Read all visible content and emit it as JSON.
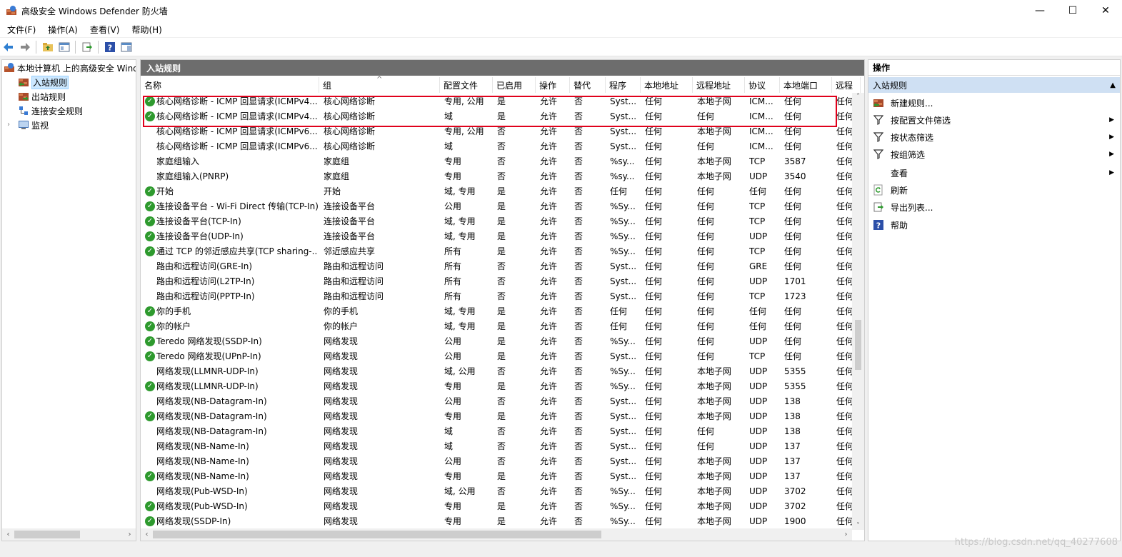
{
  "window": {
    "title": "高级安全 Windows Defender 防火墙",
    "min_glyph": "—",
    "max_glyph": "☐",
    "close_glyph": "✕"
  },
  "menu": [
    "文件(F)",
    "操作(A)",
    "查看(V)",
    "帮助(H)"
  ],
  "tree": {
    "root": "本地计算机 上的高级安全 Windows Defender 防火墙",
    "items": [
      "入站规则",
      "出站规则",
      "连接安全规则",
      "监视"
    ],
    "selected": "入站规则"
  },
  "center": {
    "header": "入站规则",
    "columns": [
      "名称",
      "组",
      "配置文件",
      "已启用",
      "操作",
      "替代",
      "程序",
      "本地地址",
      "远程地址",
      "协议",
      "本地端口",
      "远程"
    ],
    "rows": [
      {
        "enabled_icon": true,
        "cells": [
          "核心网络诊断 - ICMP 回显请求(ICMPv4...",
          "核心网络诊断",
          "专用, 公用",
          "是",
          "允许",
          "否",
          "Syst...",
          "任何",
          "本地子网",
          "ICM...",
          "任何",
          "任何"
        ]
      },
      {
        "enabled_icon": true,
        "cells": [
          "核心网络诊断 - ICMP 回显请求(ICMPv4...",
          "核心网络诊断",
          "域",
          "是",
          "允许",
          "否",
          "Syst...",
          "任何",
          "任何",
          "ICM...",
          "任何",
          "任何"
        ]
      },
      {
        "enabled_icon": false,
        "cells": [
          "核心网络诊断 - ICMP 回显请求(ICMPv6...",
          "核心网络诊断",
          "专用, 公用",
          "否",
          "允许",
          "否",
          "Syst...",
          "任何",
          "本地子网",
          "ICM...",
          "任何",
          "任何"
        ]
      },
      {
        "enabled_icon": false,
        "cells": [
          "核心网络诊断 - ICMP 回显请求(ICMPv6...",
          "核心网络诊断",
          "域",
          "否",
          "允许",
          "否",
          "Syst...",
          "任何",
          "任何",
          "ICM...",
          "任何",
          "任何"
        ]
      },
      {
        "enabled_icon": false,
        "cells": [
          "家庭组输入",
          "家庭组",
          "专用",
          "否",
          "允许",
          "否",
          "%sy...",
          "任何",
          "本地子网",
          "TCP",
          "3587",
          "任何"
        ]
      },
      {
        "enabled_icon": false,
        "cells": [
          "家庭组输入(PNRP)",
          "家庭组",
          "专用",
          "否",
          "允许",
          "否",
          "%sy...",
          "任何",
          "本地子网",
          "UDP",
          "3540",
          "任何"
        ]
      },
      {
        "enabled_icon": true,
        "cells": [
          "开始",
          "开始",
          "域, 专用",
          "是",
          "允许",
          "否",
          "任何",
          "任何",
          "任何",
          "任何",
          "任何",
          "任何"
        ]
      },
      {
        "enabled_icon": true,
        "cells": [
          "连接设备平台 - Wi-Fi Direct 传输(TCP-In)",
          "连接设备平台",
          "公用",
          "是",
          "允许",
          "否",
          "%Sy...",
          "任何",
          "任何",
          "TCP",
          "任何",
          "任何"
        ]
      },
      {
        "enabled_icon": true,
        "cells": [
          "连接设备平台(TCP-In)",
          "连接设备平台",
          "域, 专用",
          "是",
          "允许",
          "否",
          "%Sy...",
          "任何",
          "任何",
          "TCP",
          "任何",
          "任何"
        ]
      },
      {
        "enabled_icon": true,
        "cells": [
          "连接设备平台(UDP-In)",
          "连接设备平台",
          "域, 专用",
          "是",
          "允许",
          "否",
          "%Sy...",
          "任何",
          "任何",
          "UDP",
          "任何",
          "任何"
        ]
      },
      {
        "enabled_icon": true,
        "cells": [
          "通过 TCP 的邻近感应共享(TCP sharing-...",
          "邻近感应共享",
          "所有",
          "是",
          "允许",
          "否",
          "%Sy...",
          "任何",
          "任何",
          "TCP",
          "任何",
          "任何"
        ]
      },
      {
        "enabled_icon": false,
        "cells": [
          "路由和远程访问(GRE-In)",
          "路由和远程访问",
          "所有",
          "否",
          "允许",
          "否",
          "Syst...",
          "任何",
          "任何",
          "GRE",
          "任何",
          "任何"
        ]
      },
      {
        "enabled_icon": false,
        "cells": [
          "路由和远程访问(L2TP-In)",
          "路由和远程访问",
          "所有",
          "否",
          "允许",
          "否",
          "Syst...",
          "任何",
          "任何",
          "UDP",
          "1701",
          "任何"
        ]
      },
      {
        "enabled_icon": false,
        "cells": [
          "路由和远程访问(PPTP-In)",
          "路由和远程访问",
          "所有",
          "否",
          "允许",
          "否",
          "Syst...",
          "任何",
          "任何",
          "TCP",
          "1723",
          "任何"
        ]
      },
      {
        "enabled_icon": true,
        "cells": [
          "你的手机",
          "你的手机",
          "域, 专用",
          "是",
          "允许",
          "否",
          "任何",
          "任何",
          "任何",
          "任何",
          "任何",
          "任何"
        ]
      },
      {
        "enabled_icon": true,
        "cells": [
          "你的帐户",
          "你的帐户",
          "域, 专用",
          "是",
          "允许",
          "否",
          "任何",
          "任何",
          "任何",
          "任何",
          "任何",
          "任何"
        ]
      },
      {
        "enabled_icon": true,
        "cells": [
          "Teredo 网络发现(SSDP-In)",
          "网络发现",
          "公用",
          "是",
          "允许",
          "否",
          "%Sy...",
          "任何",
          "任何",
          "UDP",
          "任何",
          "任何"
        ]
      },
      {
        "enabled_icon": true,
        "cells": [
          "Teredo 网络发现(UPnP-In)",
          "网络发现",
          "公用",
          "是",
          "允许",
          "否",
          "Syst...",
          "任何",
          "任何",
          "TCP",
          "任何",
          "任何"
        ]
      },
      {
        "enabled_icon": false,
        "cells": [
          "网络发现(LLMNR-UDP-In)",
          "网络发现",
          "域, 公用",
          "否",
          "允许",
          "否",
          "%Sy...",
          "任何",
          "本地子网",
          "UDP",
          "5355",
          "任何"
        ]
      },
      {
        "enabled_icon": true,
        "cells": [
          "网络发现(LLMNR-UDP-In)",
          "网络发现",
          "专用",
          "是",
          "允许",
          "否",
          "%Sy...",
          "任何",
          "本地子网",
          "UDP",
          "5355",
          "任何"
        ]
      },
      {
        "enabled_icon": false,
        "cells": [
          "网络发现(NB-Datagram-In)",
          "网络发现",
          "公用",
          "否",
          "允许",
          "否",
          "Syst...",
          "任何",
          "本地子网",
          "UDP",
          "138",
          "任何"
        ]
      },
      {
        "enabled_icon": true,
        "cells": [
          "网络发现(NB-Datagram-In)",
          "网络发现",
          "专用",
          "是",
          "允许",
          "否",
          "Syst...",
          "任何",
          "本地子网",
          "UDP",
          "138",
          "任何"
        ]
      },
      {
        "enabled_icon": false,
        "cells": [
          "网络发现(NB-Datagram-In)",
          "网络发现",
          "域",
          "否",
          "允许",
          "否",
          "Syst...",
          "任何",
          "任何",
          "UDP",
          "138",
          "任何"
        ]
      },
      {
        "enabled_icon": false,
        "cells": [
          "网络发现(NB-Name-In)",
          "网络发现",
          "域",
          "否",
          "允许",
          "否",
          "Syst...",
          "任何",
          "任何",
          "UDP",
          "137",
          "任何"
        ]
      },
      {
        "enabled_icon": false,
        "cells": [
          "网络发现(NB-Name-In)",
          "网络发现",
          "公用",
          "否",
          "允许",
          "否",
          "Syst...",
          "任何",
          "本地子网",
          "UDP",
          "137",
          "任何"
        ]
      },
      {
        "enabled_icon": true,
        "cells": [
          "网络发现(NB-Name-In)",
          "网络发现",
          "专用",
          "是",
          "允许",
          "否",
          "Syst...",
          "任何",
          "本地子网",
          "UDP",
          "137",
          "任何"
        ]
      },
      {
        "enabled_icon": false,
        "cells": [
          "网络发现(Pub-WSD-In)",
          "网络发现",
          "域, 公用",
          "否",
          "允许",
          "否",
          "%Sy...",
          "任何",
          "本地子网",
          "UDP",
          "3702",
          "任何"
        ]
      },
      {
        "enabled_icon": true,
        "cells": [
          "网络发现(Pub-WSD-In)",
          "网络发现",
          "专用",
          "是",
          "允许",
          "否",
          "%Sy...",
          "任何",
          "本地子网",
          "UDP",
          "3702",
          "任何"
        ]
      },
      {
        "enabled_icon": true,
        "cells": [
          "网络发现(SSDP-In)",
          "网络发现",
          "专用",
          "是",
          "允许",
          "否",
          "%Sy...",
          "任何",
          "本地子网",
          "UDP",
          "1900",
          "任何"
        ]
      }
    ]
  },
  "actions": {
    "title": "操作",
    "section": "入站规则",
    "items": [
      {
        "label": "新建规则...",
        "icon": "new-rule-icon",
        "submenu": false
      },
      {
        "label": "按配置文件筛选",
        "icon": "filter-icon",
        "submenu": true
      },
      {
        "label": "按状态筛选",
        "icon": "filter-icon",
        "submenu": true
      },
      {
        "label": "按组筛选",
        "icon": "filter-icon",
        "submenu": true
      },
      {
        "label": "查看",
        "icon": "",
        "submenu": true
      },
      {
        "label": "刷新",
        "icon": "refresh-icon",
        "submenu": false
      },
      {
        "label": "导出列表...",
        "icon": "export-icon",
        "submenu": false
      },
      {
        "label": "帮助",
        "icon": "help-icon",
        "submenu": false
      }
    ]
  },
  "watermark": "https://blog.csdn.net/qq_40277608",
  "colors": {
    "check_green": "#2e9a2e",
    "highlight_red": "#e0001b",
    "pane_header": "#6d6d6d",
    "actions_section": "#cfe0f3"
  }
}
